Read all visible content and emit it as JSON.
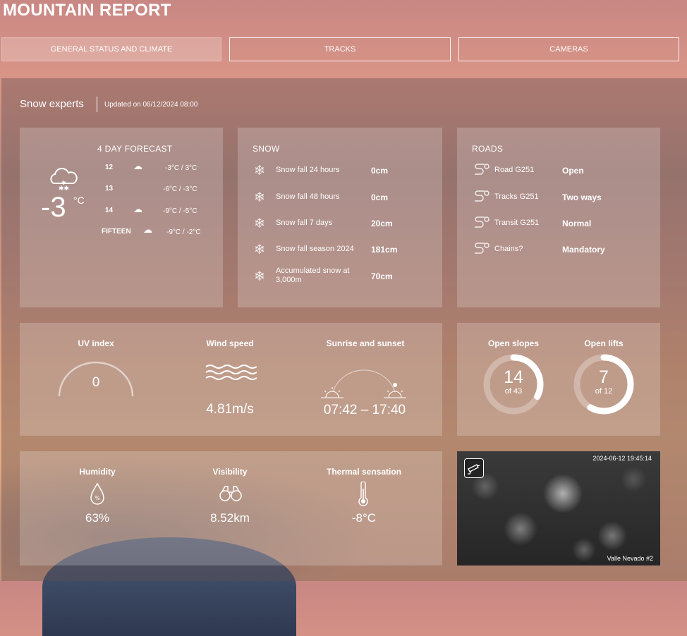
{
  "page": {
    "title": "MOUNTAIN REPORT"
  },
  "tabs": [
    {
      "label": "GENERAL STATUS AND CLIMATE",
      "active": true
    },
    {
      "label": "TRACKS",
      "active": false
    },
    {
      "label": "CAMERAS",
      "active": false
    }
  ],
  "header": {
    "source": "Snow experts",
    "updated": "Updated on 06/12/2024 08:00"
  },
  "forecast": {
    "title": "4 DAY FORECAST",
    "current_temp": "-3",
    "current_unit": "°C",
    "current_icon": "snow-cloud-icon",
    "days": [
      {
        "day": "12",
        "icon": "cloud-snow-icon",
        "range": "-3°C / 3°C"
      },
      {
        "day": "13",
        "icon": "",
        "range": "-6°C / -3°C"
      },
      {
        "day": "14",
        "icon": "cloud-snow-icon",
        "range": "-9°C / -5°C"
      },
      {
        "day": "FIFTEEN",
        "icon": "cloud-icon",
        "range": "-9°C / -2°C"
      }
    ]
  },
  "snow": {
    "title": "SNOW",
    "rows": [
      {
        "label": "Snow fall 24 hours",
        "value": "0cm"
      },
      {
        "label": "Snow fall 48 hours",
        "value": "0cm"
      },
      {
        "label": "Snow fall 7 days",
        "value": "20cm"
      },
      {
        "label": "Snow fall season 2024",
        "value": "181cm"
      },
      {
        "label": "Accumulated snow at 3,000m",
        "value": "70cm"
      }
    ]
  },
  "roads": {
    "title": "ROADS",
    "rows": [
      {
        "label": "Road G251",
        "value": "Open"
      },
      {
        "label": "Tracks G251",
        "value": "Two ways"
      },
      {
        "label": "Transit G251",
        "value": "Normal"
      },
      {
        "label": "Chains?",
        "value": "Mandatory"
      }
    ]
  },
  "climate": {
    "uv": {
      "label": "UV index",
      "value": "0"
    },
    "wind": {
      "label": "Wind speed",
      "value": "4.81m/s"
    },
    "sun": {
      "label": "Sunrise and sunset",
      "value": "07:42 – 17:40"
    }
  },
  "slopes": {
    "open_slopes": {
      "label": "Open slopes",
      "open": 14,
      "total": 43,
      "open_text": "14",
      "total_text": "of 43"
    },
    "open_lifts": {
      "label": "Open lifts",
      "open": 7,
      "total": 12,
      "open_text": "7",
      "total_text": "of 12"
    }
  },
  "conditions": {
    "humidity": {
      "label": "Humidity",
      "value": "63%",
      "icon_text": "%"
    },
    "visibility": {
      "label": "Visibility",
      "value": "8.52km"
    },
    "thermal": {
      "label": "Thermal sensation",
      "value": "-8°C"
    }
  },
  "camera": {
    "timestamp": "2024-06-12 19:45:14",
    "name": "Valle Nevado #2"
  },
  "colors": {
    "text": "#ffffff",
    "card": "rgba(255,255,255,0.20)",
    "panel": "rgba(95,75,80,0.38)"
  }
}
